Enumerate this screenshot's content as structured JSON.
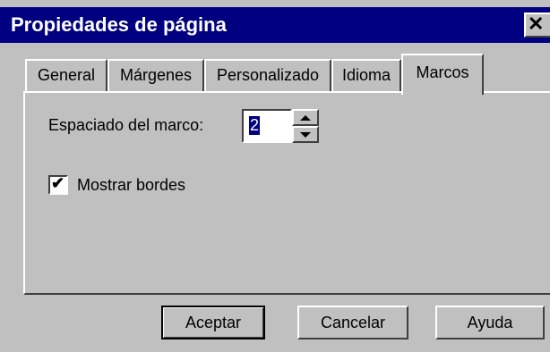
{
  "window": {
    "title": "Propiedades de página"
  },
  "tabs": [
    {
      "label": "General"
    },
    {
      "label": "Márgenes"
    },
    {
      "label": "Personalizado"
    },
    {
      "label": "Idioma"
    },
    {
      "label": "Marcos"
    }
  ],
  "marcos": {
    "spacing_label": "Espaciado del marco:",
    "spacing_value": "2",
    "show_borders_label": "Mostrar bordes",
    "show_borders_checked": true
  },
  "buttons": {
    "ok": "Aceptar",
    "cancel": "Cancelar",
    "help": "Ayuda"
  },
  "icons": {
    "close": "close-icon",
    "spin_up": "arrow-up-icon",
    "spin_down": "arrow-down-icon",
    "check": "checkmark-icon"
  }
}
